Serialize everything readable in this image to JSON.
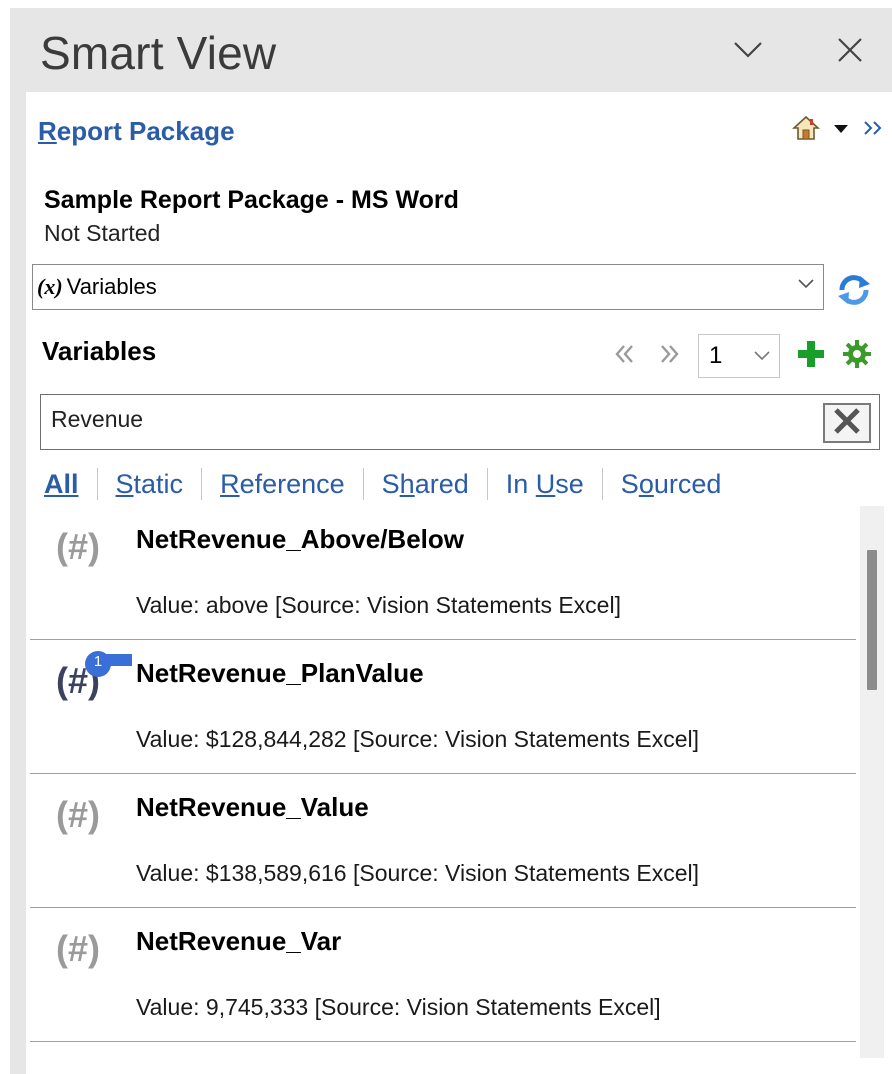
{
  "window": {
    "title": "Smart View",
    "icons": {
      "options": "chevron-down-icon",
      "close": "close-icon"
    }
  },
  "header": {
    "link_first": "R",
    "link_rest": "eport Package",
    "icons": [
      "home-icon",
      "dropdown-arrow-icon",
      "expand-double-chevron-icon"
    ]
  },
  "package": {
    "name": "Sample Report Package - MS Word",
    "status": "Not Started"
  },
  "view_select": {
    "icon_text": "(x)",
    "value": "Variables"
  },
  "variables_section": {
    "title": "Variables",
    "page": "1"
  },
  "search": {
    "value": "Revenue"
  },
  "filters": [
    {
      "pre": "",
      "u": "A",
      "post": "ll",
      "active": true
    },
    {
      "pre": "",
      "u": "S",
      "post": "tatic",
      "active": false
    },
    {
      "pre": "",
      "u": "R",
      "post": "eference",
      "active": false
    },
    {
      "pre": "S",
      "u": "h",
      "post": "ared",
      "active": false
    },
    {
      "pre": "In ",
      "u": "U",
      "post": "se",
      "active": false
    },
    {
      "pre": "S",
      "u": "o",
      "post": "urced",
      "active": false
    }
  ],
  "variables": [
    {
      "icon": "(#)",
      "name": "NetRevenue_Above/Below",
      "value": "Value: above [Source: Vision Statements Excel]",
      "highlighted": false
    },
    {
      "icon": "(#)",
      "name": "NetRevenue_PlanValue",
      "value": "Value:  $128,844,282  [Source: Vision Statements Excel]",
      "highlighted": true,
      "badge": "1"
    },
    {
      "icon": "(#)",
      "name": "NetRevenue_Value",
      "value": "Value:  $138,589,616  [Source: Vision Statements Excel]",
      "highlighted": false
    },
    {
      "icon": "(#)",
      "name": "NetRevenue_Var",
      "value": "Value:  9,745,333  [Source: Vision Statements Excel]",
      "highlighted": false
    }
  ],
  "colors": {
    "link": "#2a5ca8",
    "badge": "#3b6fd8",
    "add": "#1a9e2a",
    "gear": "#3a9a2a",
    "refresh": "#2a7ad8"
  }
}
